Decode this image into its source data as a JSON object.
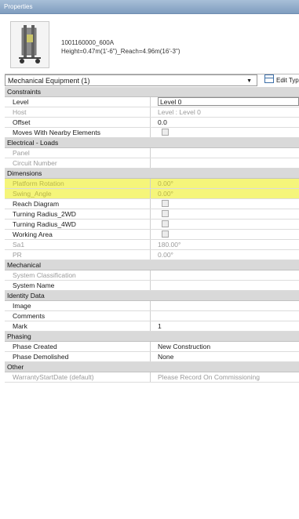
{
  "window": {
    "title": "Properties"
  },
  "type_header": {
    "name": "1001160000_600A",
    "dims": "Height=0.47m(1'-6\")_Reach=4.96m(16'-3\")"
  },
  "selector": {
    "value": "Mechanical Equipment (1)",
    "arrow": "▼",
    "edit_type_label": "Edit Type"
  },
  "groups": {
    "constraints": "Constraints",
    "electrical": "Electrical - Loads",
    "dimensions": "Dimensions",
    "mechanical": "Mechanical",
    "identity": "Identity Data",
    "phasing": "Phasing",
    "other": "Other"
  },
  "rows": {
    "level": {
      "label": "Level",
      "value": "Level 0"
    },
    "host": {
      "label": "Host",
      "value": "Level : Level 0"
    },
    "offset": {
      "label": "Offset",
      "value": "0.0"
    },
    "moves": {
      "label": "Moves With Nearby Elements"
    },
    "panel": {
      "label": "Panel",
      "value": ""
    },
    "circuit": {
      "label": "Circuit Number",
      "value": ""
    },
    "platform": {
      "label": "Platform Rotation",
      "value": "0.00°"
    },
    "swing": {
      "label": "Swing_Angle",
      "value": "0.00°"
    },
    "reach": {
      "label": "Reach Diagram"
    },
    "turning2": {
      "label": "Turning Radius_2WD"
    },
    "turning4": {
      "label": "Turning Radius_4WD"
    },
    "working": {
      "label": "Working Area"
    },
    "sa1": {
      "label": "Sa1",
      "value": "180.00°"
    },
    "pr": {
      "label": "PR",
      "value": "0.00°"
    },
    "sysclass": {
      "label": "System Classification",
      "value": ""
    },
    "sysname": {
      "label": "System Name",
      "value": ""
    },
    "image": {
      "label": "Image",
      "value": ""
    },
    "comments": {
      "label": "Comments",
      "value": ""
    },
    "mark": {
      "label": "Mark",
      "value": "1"
    },
    "phasecreated": {
      "label": "Phase Created",
      "value": "New Construction"
    },
    "phasedemolished": {
      "label": "Phase Demolished",
      "value": "None"
    },
    "warranty": {
      "label": "WarrantyStartDate (default)",
      "value": "Please Record On Commissioning"
    }
  },
  "colors": {
    "highlight": "#f5f57a",
    "group_bg": "#d9d9d9",
    "title_bar": "#8fabcb"
  }
}
